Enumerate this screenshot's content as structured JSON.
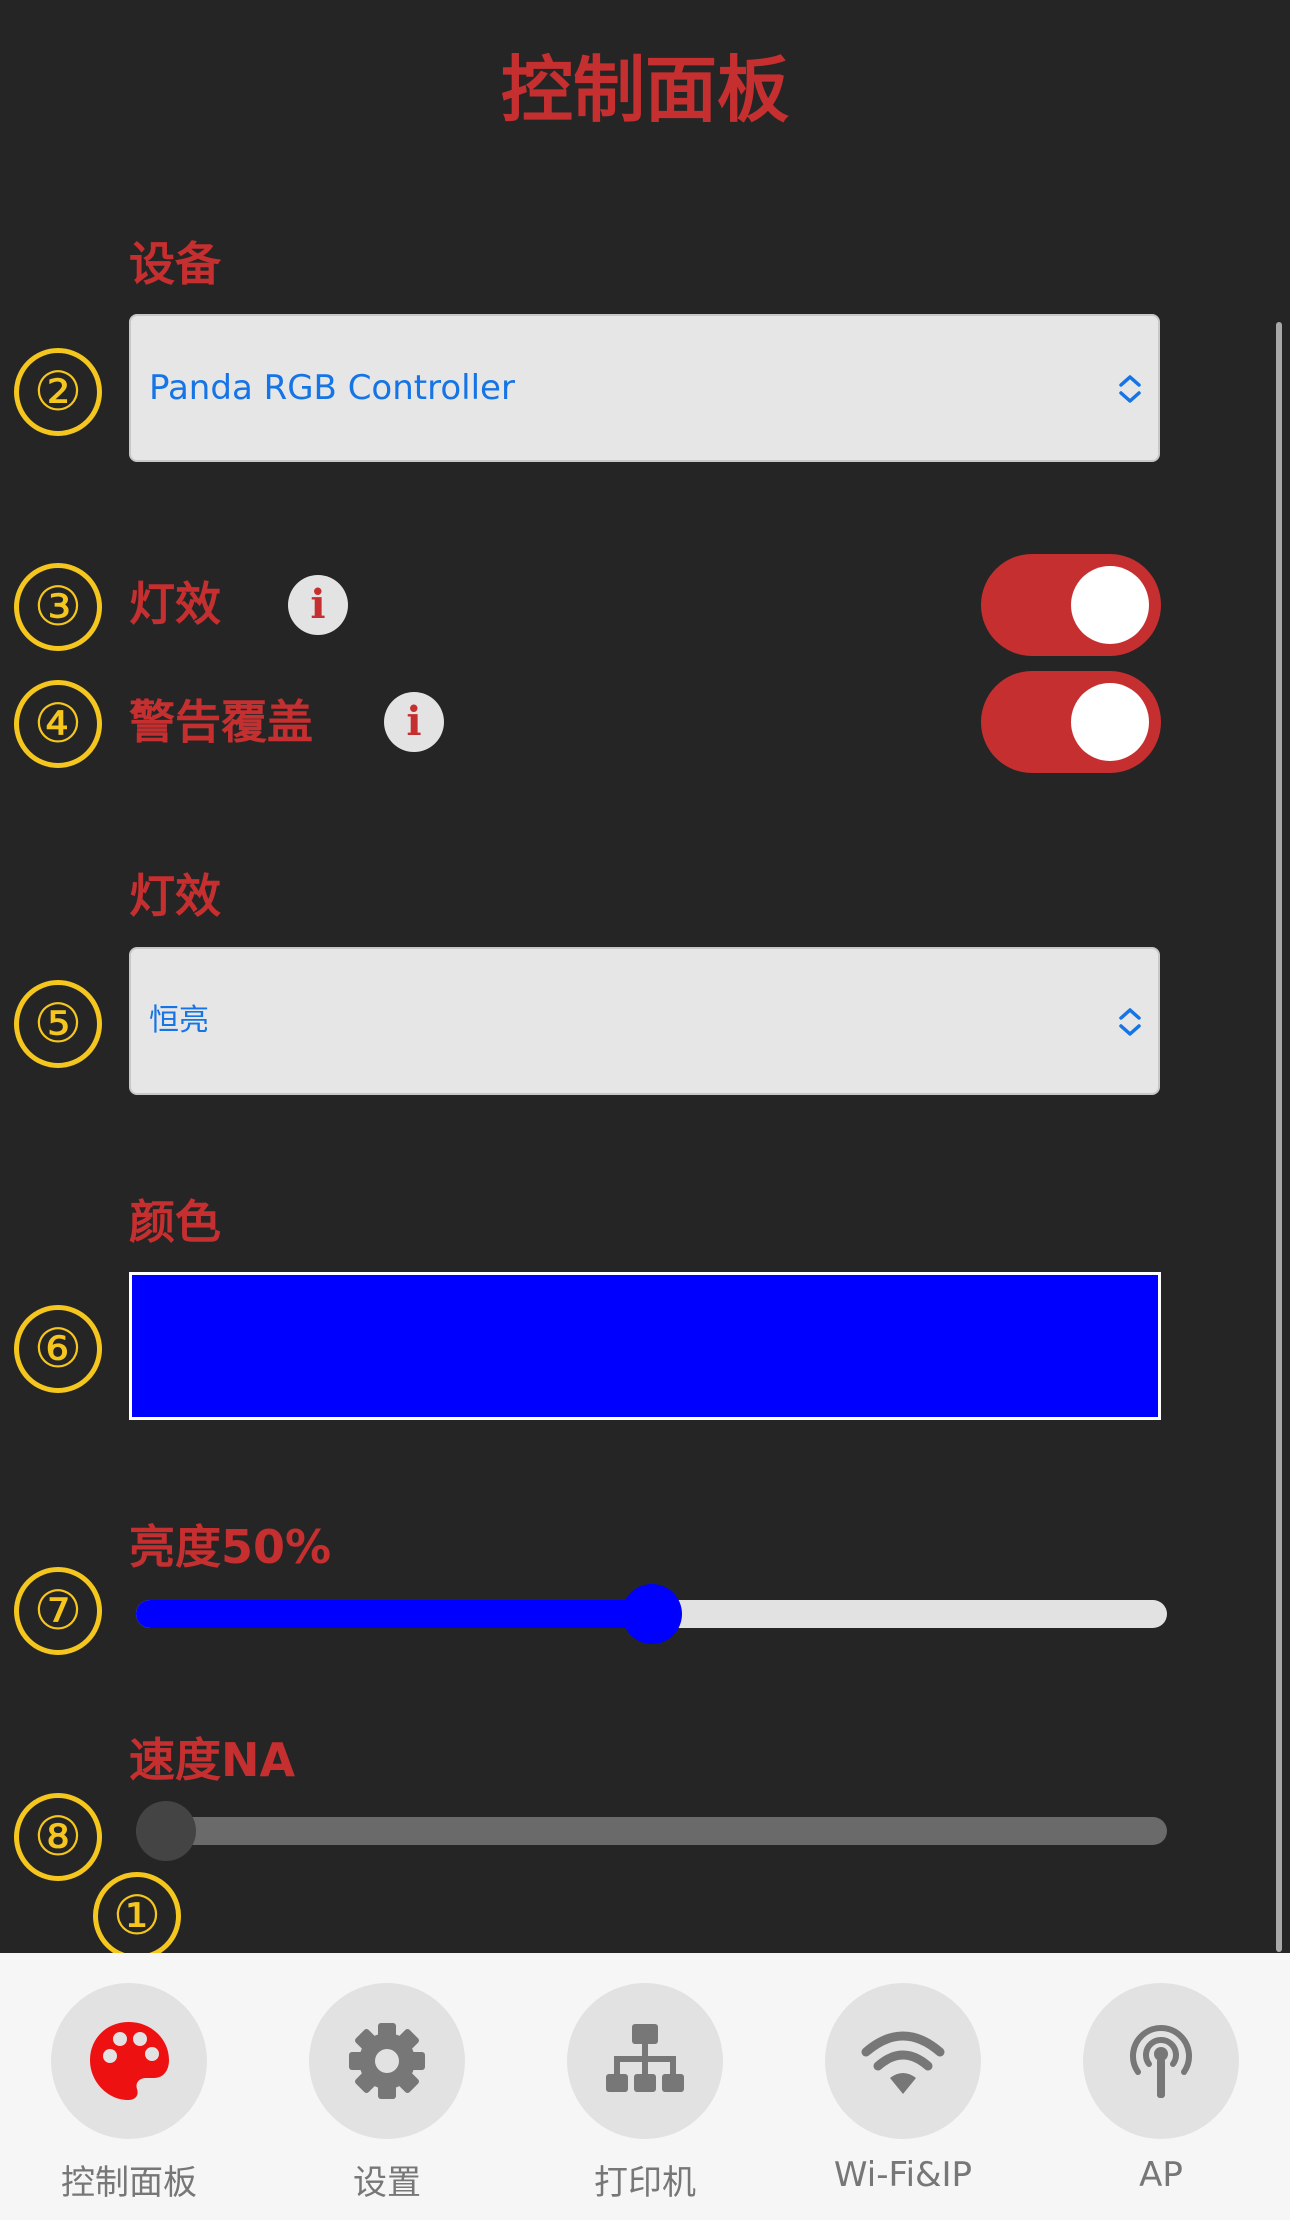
{
  "page_title": "控制面板",
  "device": {
    "label": "设备",
    "value": "Panda RGB Controller"
  },
  "light_effect_toggle": {
    "label": "灯效",
    "info": "i",
    "on": true
  },
  "warning_override_toggle": {
    "label": "警告覆盖",
    "info": "i",
    "on": true
  },
  "effect_select": {
    "label": "灯效",
    "value": "恒亮"
  },
  "color": {
    "label": "颜色",
    "value": "#0000ff"
  },
  "brightness": {
    "label": "亮度50%",
    "value_percent": 50
  },
  "speed": {
    "label": "速度NA",
    "value_percent": 0
  },
  "markers": [
    "②",
    "③",
    "④",
    "⑤",
    "⑥",
    "⑦",
    "⑧",
    "①"
  ],
  "tabs": [
    {
      "label": "控制面板",
      "icon": "palette-icon",
      "active": true
    },
    {
      "label": "设置",
      "icon": "gear-icon",
      "active": false
    },
    {
      "label": "打印机",
      "icon": "network-icon",
      "active": false
    },
    {
      "label": "Wi-Fi&IP",
      "icon": "wifi-icon",
      "active": false
    },
    {
      "label": "AP",
      "icon": "antenna-icon",
      "active": false
    }
  ],
  "colors": {
    "accent": "#c62f2f",
    "marker": "#f5c71e",
    "slider_fill": "#0000ff",
    "link": "#1574e6"
  }
}
